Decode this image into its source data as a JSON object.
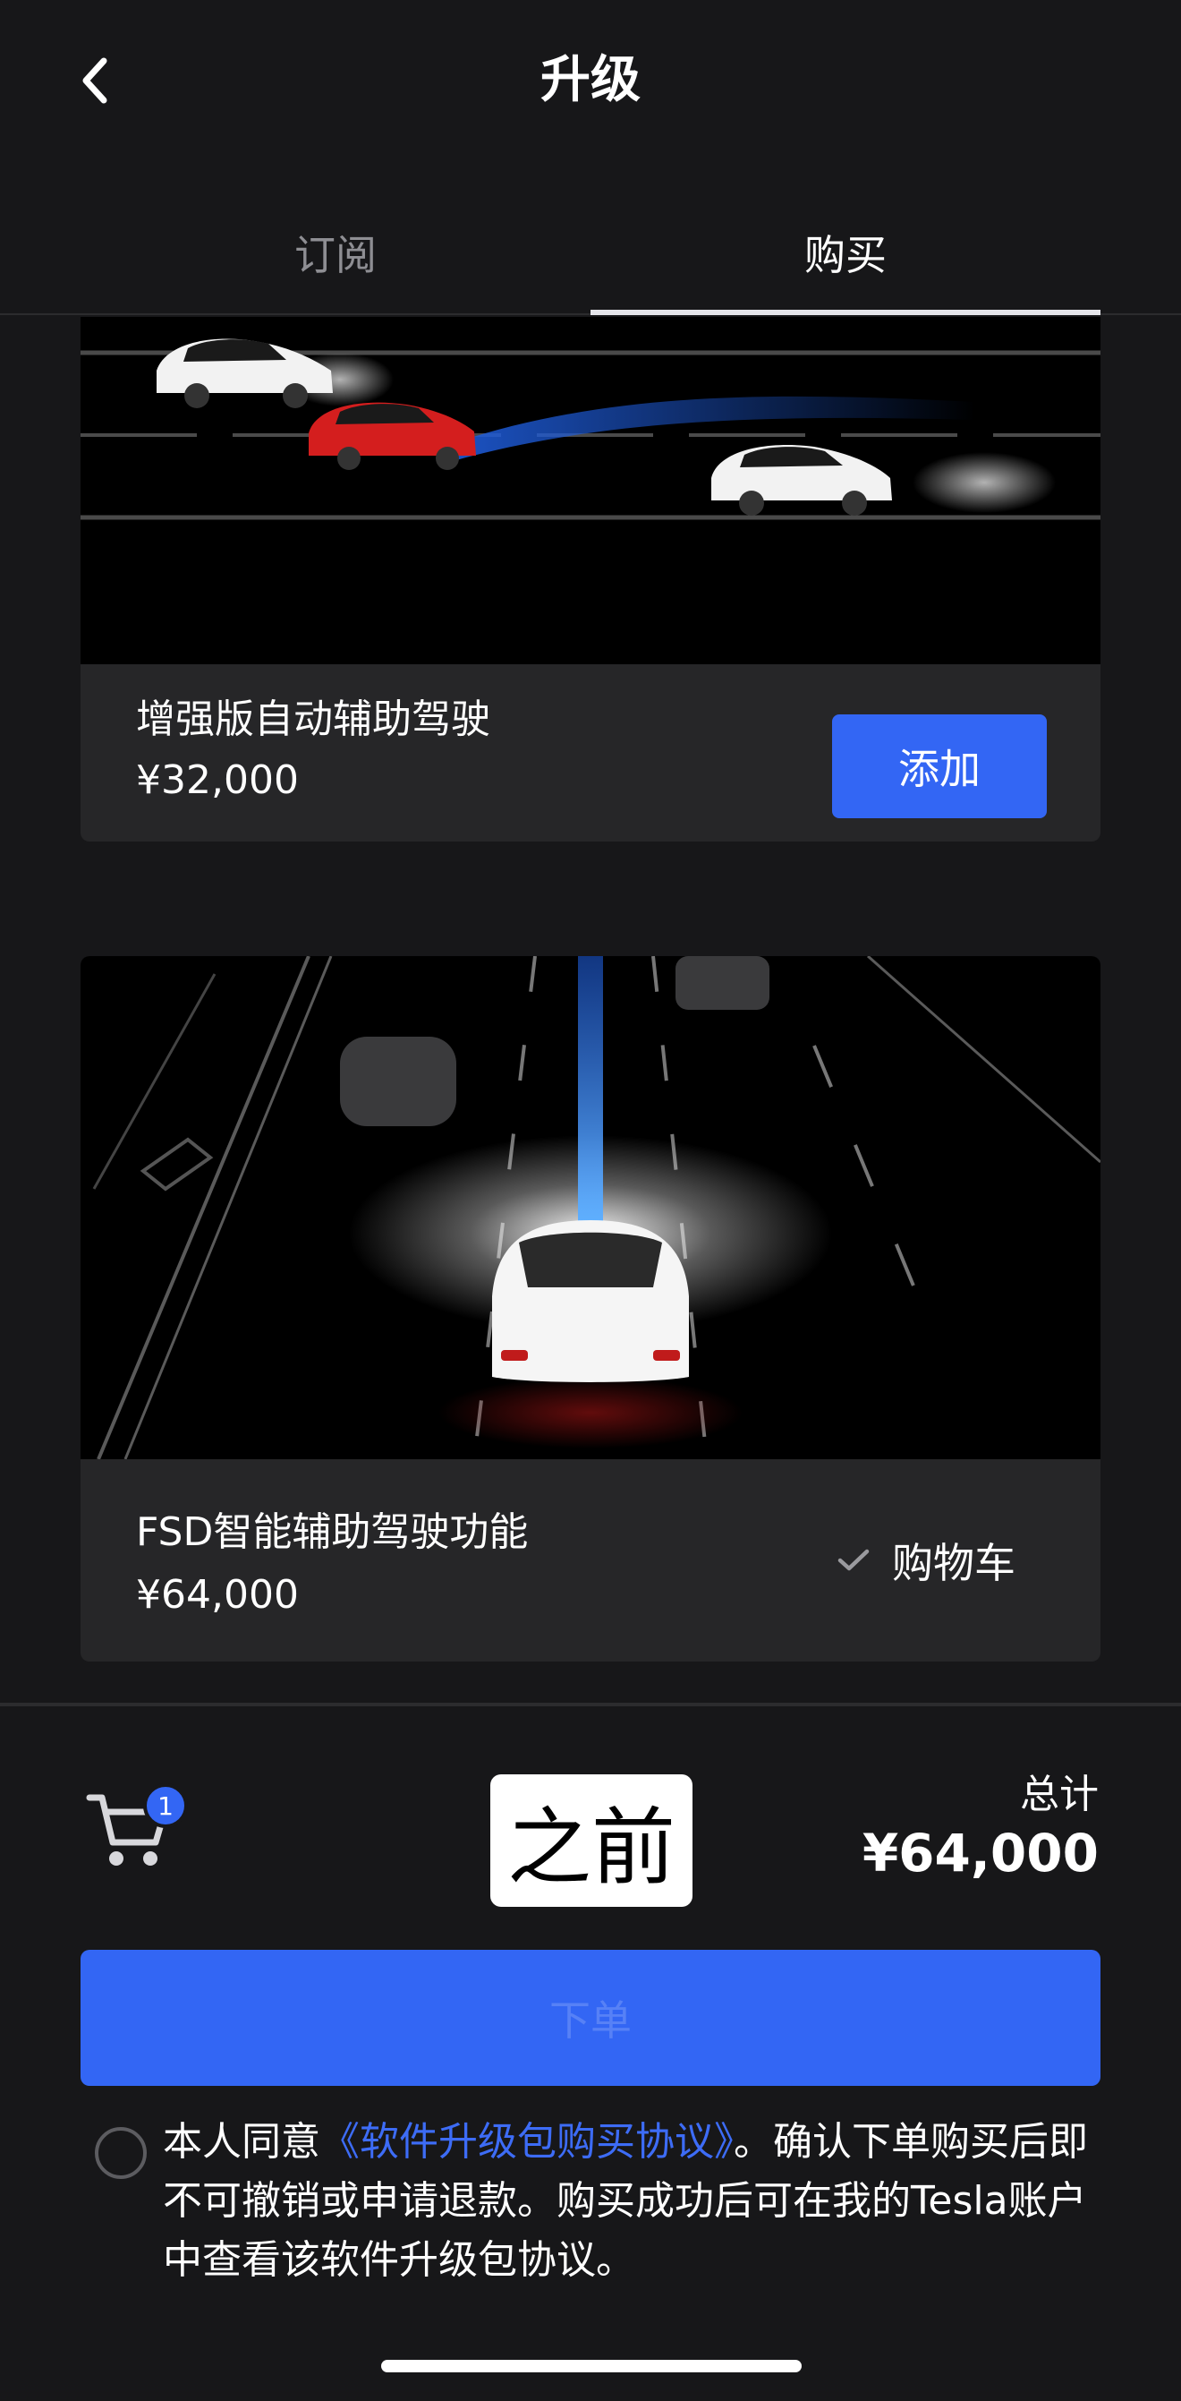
{
  "header": {
    "title": "升级",
    "back_icon": "chevron-left-icon"
  },
  "tabs": [
    {
      "label": "订阅",
      "active": false
    },
    {
      "label": "购买",
      "active": true
    }
  ],
  "products": [
    {
      "name": "增强版自动辅助驾驶",
      "price": "¥32,000",
      "action_label": "添加",
      "in_cart": false
    },
    {
      "name": "FSD智能辅助驾驶功能",
      "price": "¥64,000",
      "action_label": "购物车",
      "in_cart": true,
      "action_icon": "checkmark-icon"
    }
  ],
  "cart": {
    "count": "1",
    "icon": "shopping-cart-icon"
  },
  "watermark": "之前",
  "total": {
    "label": "总计",
    "value": "¥64,000"
  },
  "checkout": {
    "label": "下单"
  },
  "agreement": {
    "prefix": "本人同意",
    "link": "《软件升级包购买协议》",
    "suffix": "。确认下单购买后即不可撤销或申请退款。购买成功后可在我的Tesla账户中查看该软件升级包协议。"
  },
  "colors": {
    "accent": "#3366f4",
    "background": "#171719",
    "card": "#262628",
    "link": "#3d6cf6"
  }
}
